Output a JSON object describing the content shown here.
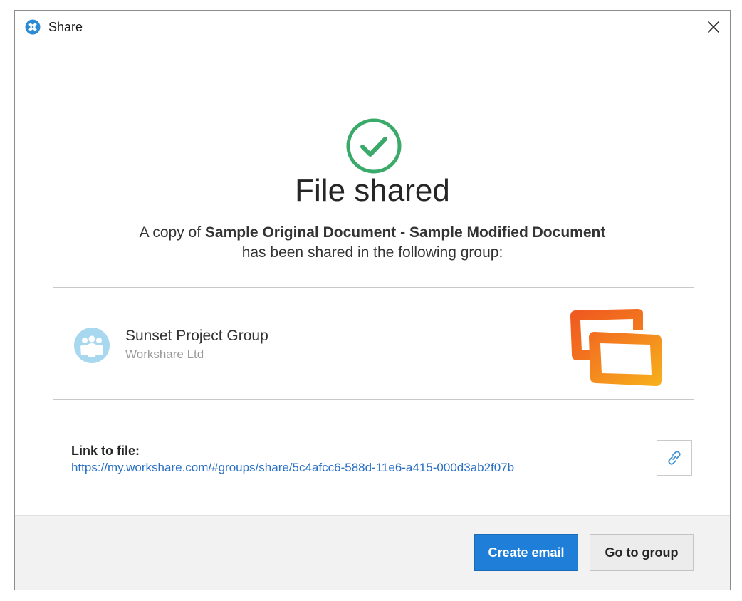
{
  "window": {
    "title": "Share",
    "app_icon": "workshare-logo-icon",
    "close_icon": "close-icon"
  },
  "status": {
    "icon": "check-circle-icon",
    "heading": "File shared",
    "message_prefix": "A copy of ",
    "document_name": "Sample Original Document - Sample Modified Document",
    "message_suffix": "has been shared in the following group:"
  },
  "group": {
    "avatar_icon": "group-people-icon",
    "name": "Sunset Project Group",
    "organization": "Workshare Ltd",
    "logo_icon": "group-logo-icon"
  },
  "link": {
    "label": "Link to file:",
    "url": "https://my.workshare.com/#groups/share/5c4afcc6-588d-11e6-a415-000d3ab2f07b",
    "copy_icon": "link-icon"
  },
  "footer": {
    "primary_button": "Create email",
    "secondary_button": "Go to group"
  },
  "colors": {
    "accent": "#1f7fd8",
    "success": "#3aaa6a",
    "link": "#2a6fc4",
    "logo_orange": "#f26b21",
    "logo_yellow": "#f7a21b"
  }
}
